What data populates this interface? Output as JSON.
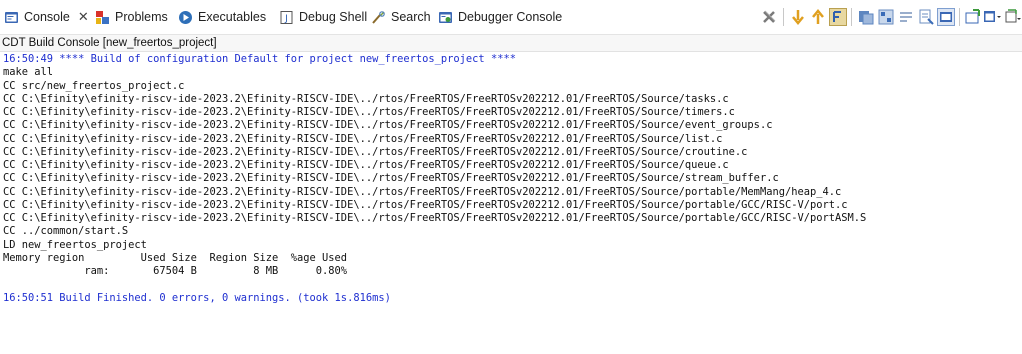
{
  "tabs": [
    {
      "label": "Console",
      "icon": "console-icon",
      "active": true
    },
    {
      "label": "Problems",
      "icon": "problems-icon"
    },
    {
      "label": "Executables",
      "icon": "executables-icon"
    },
    {
      "label": "Debug Shell",
      "icon": "debug-shell-icon"
    },
    {
      "label": "Search",
      "icon": "search-icon"
    },
    {
      "label": "Debugger Console",
      "icon": "debugger-console-icon"
    }
  ],
  "toolbar_icons": [
    "remove-all-icon",
    "next-error-icon",
    "previous-error-icon",
    "show-errors-icon",
    "copy-icon",
    "pin-console-icon",
    "word-wrap-icon",
    "scroll-lock-icon",
    "display-selected-console-icon",
    "new-console-icon",
    "open-console-icon",
    "view-menu-icon"
  ],
  "console_title": "CDT Build Console [new_freertos_project]",
  "lines": [
    {
      "text": "16:50:49 **** Build of configuration Default for project new_freertos_project ****",
      "color": "#1f2fd0"
    },
    {
      "text": "make all"
    },
    {
      "text": "CC src/new_freertos_project.c"
    },
    {
      "text": "CC C:\\Efinity\\efinity-riscv-ide-2023.2\\Efinity-RISCV-IDE\\../rtos/FreeRTOS/FreeRTOSv202212.01/FreeRTOS/Source/tasks.c"
    },
    {
      "text": "CC C:\\Efinity\\efinity-riscv-ide-2023.2\\Efinity-RISCV-IDE\\../rtos/FreeRTOS/FreeRTOSv202212.01/FreeRTOS/Source/timers.c"
    },
    {
      "text": "CC C:\\Efinity\\efinity-riscv-ide-2023.2\\Efinity-RISCV-IDE\\../rtos/FreeRTOS/FreeRTOSv202212.01/FreeRTOS/Source/event_groups.c"
    },
    {
      "text": "CC C:\\Efinity\\efinity-riscv-ide-2023.2\\Efinity-RISCV-IDE\\../rtos/FreeRTOS/FreeRTOSv202212.01/FreeRTOS/Source/list.c"
    },
    {
      "text": "CC C:\\Efinity\\efinity-riscv-ide-2023.2\\Efinity-RISCV-IDE\\../rtos/FreeRTOS/FreeRTOSv202212.01/FreeRTOS/Source/croutine.c"
    },
    {
      "text": "CC C:\\Efinity\\efinity-riscv-ide-2023.2\\Efinity-RISCV-IDE\\../rtos/FreeRTOS/FreeRTOSv202212.01/FreeRTOS/Source/queue.c"
    },
    {
      "text": "CC C:\\Efinity\\efinity-riscv-ide-2023.2\\Efinity-RISCV-IDE\\../rtos/FreeRTOS/FreeRTOSv202212.01/FreeRTOS/Source/stream_buffer.c"
    },
    {
      "text": "CC C:\\Efinity\\efinity-riscv-ide-2023.2\\Efinity-RISCV-IDE\\../rtos/FreeRTOS/FreeRTOSv202212.01/FreeRTOS/Source/portable/MemMang/heap_4.c"
    },
    {
      "text": "CC C:\\Efinity\\efinity-riscv-ide-2023.2\\Efinity-RISCV-IDE\\../rtos/FreeRTOS/FreeRTOSv202212.01/FreeRTOS/Source/portable/GCC/RISC-V/port.c"
    },
    {
      "text": "CC C:\\Efinity\\efinity-riscv-ide-2023.2\\Efinity-RISCV-IDE\\../rtos/FreeRTOS/FreeRTOSv202212.01/FreeRTOS/Source/portable/GCC/RISC-V/portASM.S"
    },
    {
      "text": "CC ../common/start.S"
    },
    {
      "text": "LD new_freertos_project"
    },
    {
      "text": "Memory region         Used Size  Region Size  %age Used"
    },
    {
      "text": "             ram:       67504 B         8 MB      0.80%"
    },
    {
      "text": ""
    },
    {
      "text": "16:50:51 Build Finished. 0 errors, 0 warnings. (took 1s.816ms)",
      "color": "#1f2fd0"
    }
  ],
  "colors": {
    "build_message": "#1f2fd0",
    "text": "#111111"
  }
}
